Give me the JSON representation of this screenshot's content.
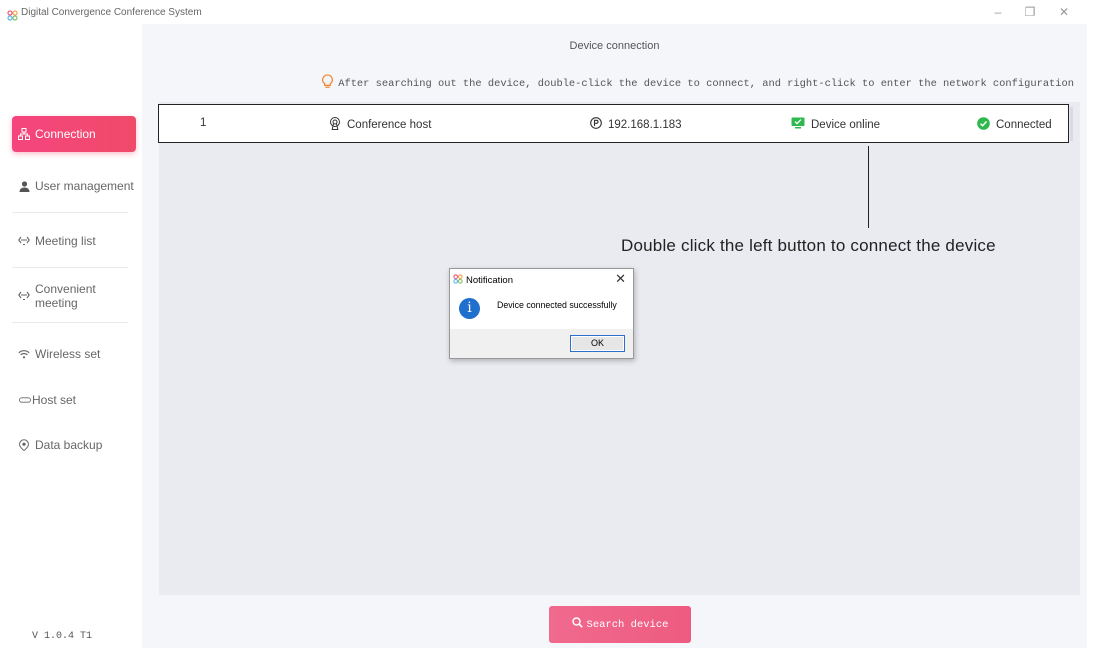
{
  "window": {
    "title": "Digital Convergence Conference System",
    "minimize_glyph": "–",
    "restore_glyph": "❐",
    "close_glyph": "✕"
  },
  "sidebar": {
    "items": [
      {
        "label": "Connection",
        "icon": "network-icon",
        "active": true
      },
      {
        "label": "User management",
        "icon": "user-icon"
      },
      {
        "label": "Meeting list",
        "icon": "arrows-icon"
      },
      {
        "label": "Convenient meeting",
        "icon": "arrows-icon"
      },
      {
        "label": "Wireless set",
        "icon": "wifi-icon"
      },
      {
        "label": "Host set",
        "icon": "host-icon"
      },
      {
        "label": "Data backup",
        "icon": "backup-icon"
      }
    ],
    "version": "V 1.0.4 T1"
  },
  "main": {
    "heading": "Device connection",
    "hint": "After searching out the device, double-click the device to connect, and right-click to enter the network configuration",
    "devices": [
      {
        "index": "1",
        "name": "Conference host",
        "ip": "192.168.1.183",
        "status": "Device online",
        "connection": "Connected"
      }
    ],
    "search_button": "Search device"
  },
  "annotation": {
    "text": "Double click the left button to connect the device"
  },
  "dialog": {
    "title": "Notification",
    "message": "Device connected successfully",
    "ok_label": "OK",
    "close_glyph": "✕",
    "info_glyph": "i"
  },
  "colors": {
    "accent": "#f04a6a",
    "online_green": "#2fb84d",
    "hint_orange": "#f08a3c",
    "info_blue": "#1f6fce"
  }
}
